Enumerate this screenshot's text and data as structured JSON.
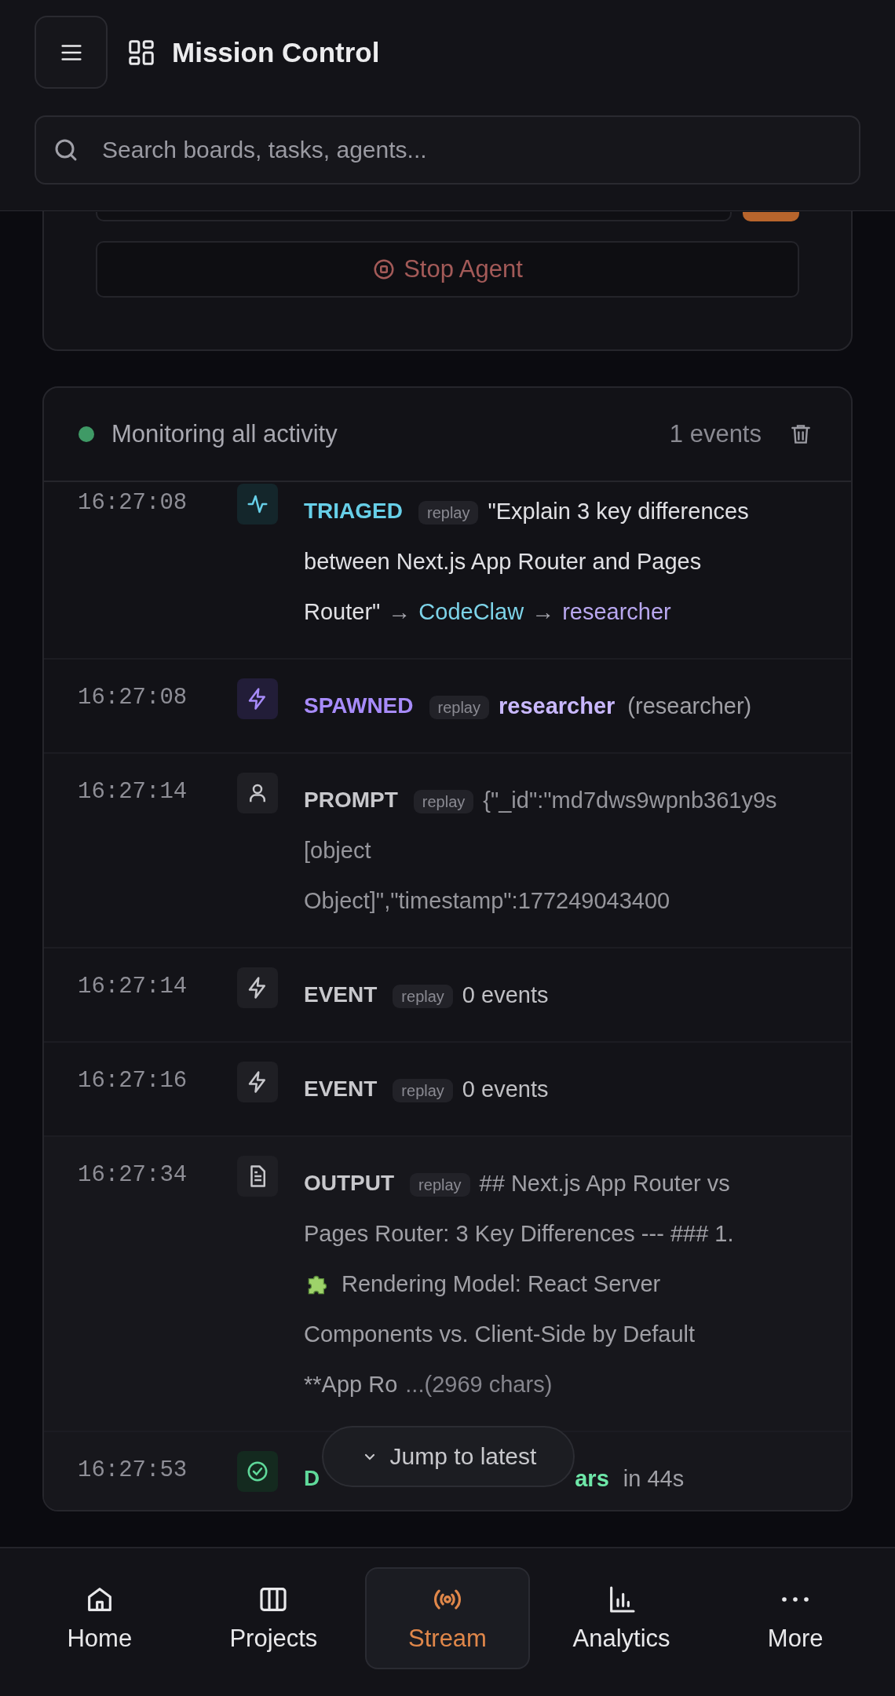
{
  "header": {
    "title": "Mission Control",
    "search": {
      "placeholder": "Search boards, tasks, agents..."
    }
  },
  "agent_panel": {
    "stop_button": "Stop Agent"
  },
  "activity": {
    "status": "Monitoring all activity",
    "live": true,
    "count": "1 events",
    "events": [
      {
        "time": "16:27:08",
        "kind": "triaged",
        "label": "TRIAGED",
        "replay": "replay",
        "lines": [
          [
            {
              "kind": "quote",
              "text": "\"Explain 3 key differences"
            }
          ],
          [
            {
              "kind": "quote",
              "text": "between Next.js App Router and Pages"
            }
          ],
          [
            {
              "kind": "quote",
              "text": "Router\""
            },
            {
              "kind": "arrow",
              "text": "→"
            },
            {
              "kind": "source",
              "text": "CodeClaw"
            },
            {
              "kind": "arrow",
              "text": "→"
            },
            {
              "kind": "agent",
              "text": "researcher"
            }
          ]
        ]
      },
      {
        "time": "16:27:08",
        "kind": "spawned",
        "label": "SPAWNED",
        "replay": "replay",
        "lines": [
          [
            {
              "kind": "agent_name",
              "text": "researcher"
            },
            {
              "kind": "meta",
              "text": "(researcher)"
            }
          ]
        ]
      },
      {
        "time": "16:27:14",
        "kind": "prompt",
        "label": "PROMPT",
        "replay": "replay",
        "lines": [
          [
            {
              "kind": "dim",
              "text": "{\"_id\":\"md7dws9wpnb361y9s"
            }
          ],
          [
            {
              "kind": "dim",
              "text": "[object"
            }
          ],
          [
            {
              "kind": "dim",
              "text": "Object]\",\"timestamp\":177249043400"
            }
          ]
        ]
      },
      {
        "time": "16:27:14",
        "kind": "event",
        "label": "EVENT",
        "replay": "replay",
        "lines": [
          [
            {
              "kind": "body",
              "text": "0 events"
            }
          ]
        ]
      },
      {
        "time": "16:27:16",
        "kind": "event",
        "label": "EVENT",
        "replay": "replay",
        "lines": [
          [
            {
              "kind": "body",
              "text": "0 events"
            }
          ]
        ]
      },
      {
        "time": "16:27:34",
        "kind": "output",
        "label": "OUTPUT",
        "replay": "replay",
        "lines": [
          [
            {
              "kind": "meta",
              "text": "## Next.js App Router vs"
            }
          ],
          [
            {
              "kind": "meta",
              "text": "Pages Router: 3 Key Differences --- ### 1."
            }
          ],
          [
            {
              "kind": "puzzle"
            },
            {
              "kind": "meta",
              "text": "Rendering Model: React Server"
            }
          ],
          [
            {
              "kind": "meta",
              "text": "Components vs. Client-Side by Default"
            }
          ],
          [
            {
              "kind": "meta",
              "text": "**App Ro"
            },
            {
              "kind": "muted",
              "text": "...(2969 chars)"
            }
          ]
        ]
      },
      {
        "time": "16:27:53",
        "kind": "done",
        "label": "D",
        "covered": true,
        "lines": [
          [
            {
              "kind": "success",
              "text": "ars"
            },
            {
              "kind": "meta",
              "text": "in 44s"
            }
          ]
        ]
      }
    ],
    "jump_button": "Jump to latest"
  },
  "nav": [
    {
      "label": "Home",
      "selected": false
    },
    {
      "label": "Projects",
      "selected": false
    },
    {
      "label": "Stream",
      "selected": true
    },
    {
      "label": "Analytics",
      "selected": false
    },
    {
      "label": "More",
      "selected": false
    }
  ]
}
